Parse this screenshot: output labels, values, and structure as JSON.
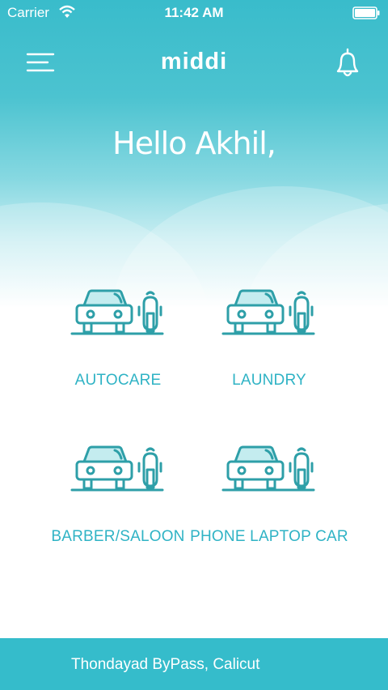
{
  "status_bar": {
    "carrier": "Carrier",
    "time": "11:42 AM",
    "wifi_icon": "wifi-icon",
    "battery_icon": "battery-icon"
  },
  "nav": {
    "brand": "middi",
    "menu_icon": "hamburger-menu-icon",
    "bell_icon": "bell-icon"
  },
  "greeting": "Hello Akhil,",
  "services": [
    {
      "label": "AUTOCARE",
      "icon": "car-scooter-icon"
    },
    {
      "label": "LAUNDRY",
      "icon": "car-scooter-icon"
    },
    {
      "label": "BARBER/SALOON",
      "icon": "car-scooter-icon"
    },
    {
      "label": "PHONE LAPTOP CAR",
      "icon": "car-scooter-icon"
    }
  ],
  "footer": {
    "location": "Thondayad ByPass, Calicut"
  },
  "colors": {
    "primary": "#35bccb",
    "icon": "#2e9fa8",
    "label": "#2fb3c5"
  }
}
